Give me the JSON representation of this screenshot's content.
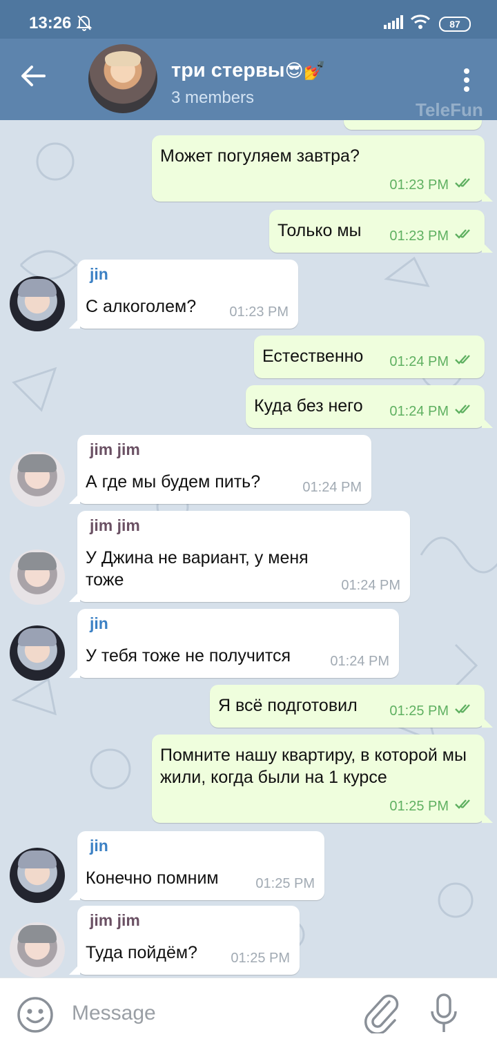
{
  "status": {
    "time": "13:26",
    "battery": "87"
  },
  "header": {
    "title": "три стервы",
    "title_emoji": "😎💅",
    "subtitle": "3 members",
    "watermark": "TeleFun"
  },
  "messages": [
    {
      "dir": "out",
      "text": "Может погуляем завтра?",
      "time": "01:23 PM"
    },
    {
      "dir": "out",
      "text": "Только мы",
      "time": "01:23 PM"
    },
    {
      "dir": "in",
      "sender": "jin",
      "text": "С алкоголем?",
      "time": "01:23 PM"
    },
    {
      "dir": "out",
      "text": "Естественно",
      "time": "01:24 PM"
    },
    {
      "dir": "out",
      "text": "Куда без него",
      "time": "01:24 PM"
    },
    {
      "dir": "in",
      "sender": "jim jim",
      "text": "А где мы будем пить?",
      "time": "01:24 PM"
    },
    {
      "dir": "in",
      "sender": "jim jim",
      "text": "У Джина не вариант, у меня тоже",
      "time": "01:24 PM"
    },
    {
      "dir": "in",
      "sender": "jin",
      "text": "У тебя тоже не получится",
      "time": "01:24 PM"
    },
    {
      "dir": "out",
      "text": "Я всё подготовил",
      "time": "01:25 PM"
    },
    {
      "dir": "out",
      "text": "Помните нашу квартиру, в которой мы жили, когда были на 1 курсе",
      "time": "01:25 PM"
    },
    {
      "dir": "in",
      "sender": "jin",
      "text": "Конечно помним",
      "time": "01:25 PM"
    },
    {
      "dir": "in",
      "sender": "jim jim",
      "text": "Туда пойдём?",
      "time": "01:25 PM"
    }
  ],
  "input": {
    "placeholder": "Message"
  },
  "colors": {
    "header": "#5d84ad",
    "out_bubble": "#effedd",
    "read_check": "#5fb061"
  }
}
